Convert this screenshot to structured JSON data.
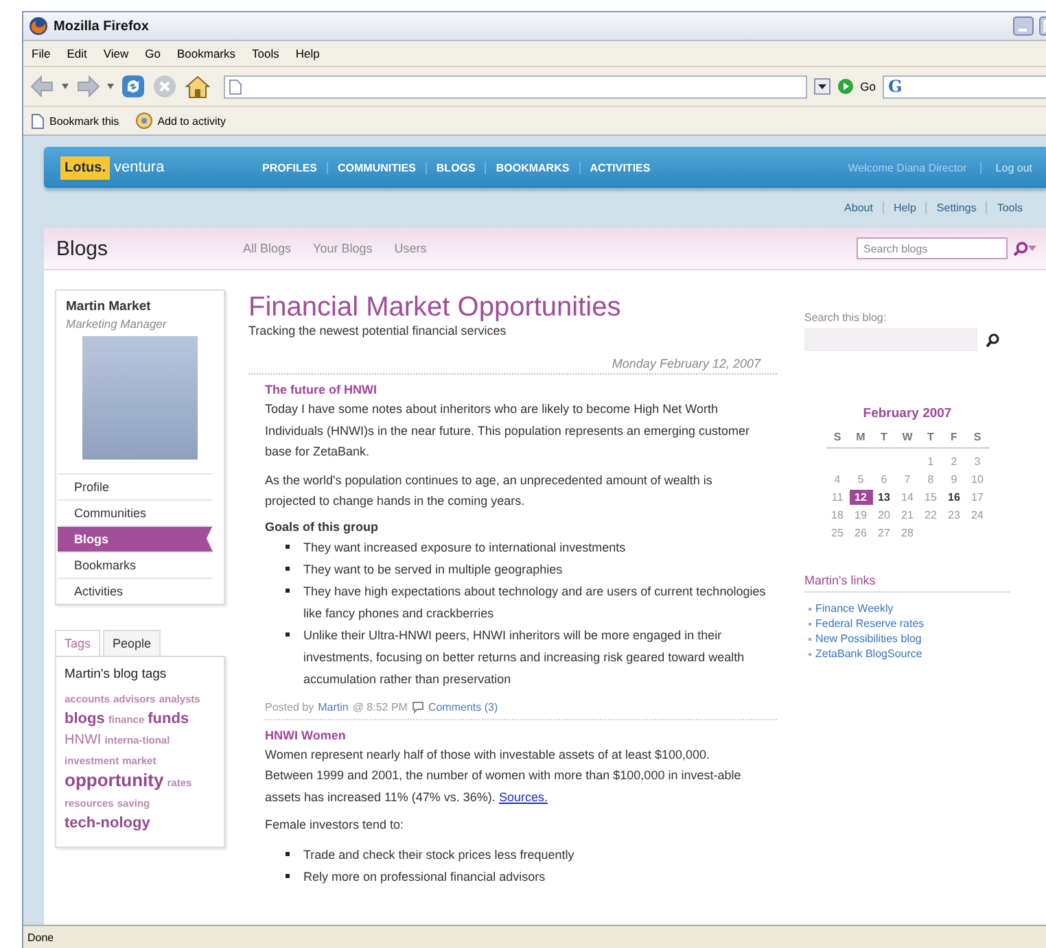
{
  "window": {
    "title": "Mozilla Firefox"
  },
  "menu": [
    "File",
    "Edit",
    "View",
    "Go",
    "Bookmarks",
    "Tools",
    "Help"
  ],
  "toolbar": {
    "go_label": "Go",
    "search_engine": "G"
  },
  "bookmarks_bar": [
    "Bookmark this",
    "Add to activity"
  ],
  "app": {
    "logo": {
      "brand": "Lotus.",
      "product": "ventura"
    },
    "nav": [
      "PROFILES",
      "COMMUNITIES",
      "BLOGS",
      "BOOKMARKS",
      "ACTIVITIES"
    ],
    "welcome": "Welcome Diana Director",
    "logout": "Log out",
    "utility_links": [
      "About",
      "Help",
      "Settings",
      "Tools"
    ]
  },
  "blogs_header": {
    "title": "Blogs",
    "tabs": [
      "All Blogs",
      "Your Blogs",
      "Users"
    ],
    "search_placeholder": "Search blogs"
  },
  "profile": {
    "name": "Martin Market",
    "role": "Marketing Manager",
    "menu": [
      {
        "label": "Profile",
        "selected": false
      },
      {
        "label": "Communities",
        "selected": false
      },
      {
        "label": "Blogs",
        "selected": true
      },
      {
        "label": "Bookmarks",
        "selected": false
      },
      {
        "label": "Activities",
        "selected": false
      }
    ]
  },
  "tag_panel": {
    "tabs": [
      {
        "label": "Tags",
        "selected": true
      },
      {
        "label": "People",
        "selected": false
      }
    ],
    "heading": "Martin's blog tags",
    "tags": [
      {
        "text": "accounts",
        "kind": "small"
      },
      {
        "text": "advisors",
        "kind": "small"
      },
      {
        "text": "analysts",
        "kind": "small"
      },
      {
        "text": "blogs",
        "kind": "bold"
      },
      {
        "text": "finance",
        "kind": "small"
      },
      {
        "text": "funds",
        "kind": "bold"
      },
      {
        "text": "HNWI",
        "kind": "plain"
      },
      {
        "text": "interna-tional",
        "kind": "small"
      },
      {
        "text": "investment",
        "kind": "small"
      },
      {
        "text": "market",
        "kind": "small"
      },
      {
        "text": "opportunity",
        "kind": "large"
      },
      {
        "text": "rates",
        "kind": "small"
      },
      {
        "text": "resources",
        "kind": "small"
      },
      {
        "text": "saving",
        "kind": "small"
      },
      {
        "text": "tech-nology",
        "kind": "bold"
      }
    ]
  },
  "blog": {
    "title": "Financial Market Opportunities",
    "subtitle": "Tracking the newest potential financial services"
  },
  "posts": [
    {
      "date": "Monday February 12, 2007",
      "title": "The future of HNWI",
      "body": [
        {
          "kind": "paragraph",
          "text": "Today I have some notes about inheritors who are likely to become High Net Worth Individuals (HNWI)s in the near future. This population represents an emerging customer base for ZetaBank."
        },
        {
          "kind": "paragraph",
          "text": "As the world's population continues to age, an unprecedented amount of wealth is projected to change hands in the coming years."
        },
        {
          "kind": "heading",
          "text": "Goals of this group"
        },
        {
          "kind": "list",
          "items": [
            "They want increased exposure to international investments",
            "They want to be served in multiple geographies",
            "They have high expectations about technology and are users of current technologies like fancy phones and crackberries",
            "Unlike their Ultra-HNWI peers, HNWI inheritors will be more engaged in their investments, focusing on better returns and increasing risk geared toward wealth accumulation rather than preservation"
          ]
        }
      ],
      "meta": {
        "posted_by": "Posted by",
        "author": "Martin",
        "time": "@ 8:52 PM",
        "comments": "Comments (3)"
      }
    },
    {
      "title": "HNWI Women",
      "body": [
        {
          "kind": "paragraph",
          "text": "Women represent nearly half of those with investable assets of at least $100,000. Between 1999 and 2001, the number of women with more than $100,000 in invest-able assets has increased 11% (47% vs. 36%).",
          "link": "Sources."
        },
        {
          "kind": "paragraph",
          "text": "Female investors tend to:"
        },
        {
          "kind": "list",
          "items": [
            "Trade and check their stock prices less frequently",
            "Rely more on professional financial advisors"
          ]
        }
      ]
    }
  ],
  "right": {
    "search_label": "Search this blog:",
    "calendar": {
      "title": "February 2007",
      "weekdays": [
        "S",
        "M",
        "T",
        "W",
        "T",
        "F",
        "S"
      ],
      "weeks": [
        [
          {
            "day": "1",
            "selected": false,
            "bold": false
          },
          {
            "day": "2",
            "selected": false,
            "bold": false
          },
          {
            "day": "3",
            "selected": false,
            "bold": false
          }
        ],
        [
          {
            "day": "4",
            "selected": false,
            "bold": false
          },
          {
            "day": "5",
            "selected": false,
            "bold": false
          },
          {
            "day": "6",
            "selected": false,
            "bold": false
          },
          {
            "day": "7",
            "selected": false,
            "bold": false
          },
          {
            "day": "8",
            "selected": false,
            "bold": false
          },
          {
            "day": "9",
            "selected": false,
            "bold": false
          },
          {
            "day": "10",
            "selected": false,
            "bold": false
          }
        ],
        [
          {
            "day": "11",
            "selected": false,
            "bold": false
          },
          {
            "day": "12",
            "selected": true,
            "bold": true
          },
          {
            "day": "13",
            "selected": false,
            "bold": true
          },
          {
            "day": "14",
            "selected": false,
            "bold": false
          },
          {
            "day": "15",
            "selected": false,
            "bold": false
          },
          {
            "day": "16",
            "selected": false,
            "bold": true
          },
          {
            "day": "17",
            "selected": false,
            "bold": false
          }
        ],
        [
          {
            "day": "18",
            "selected": false,
            "bold": false
          },
          {
            "day": "19",
            "selected": false,
            "bold": false
          },
          {
            "day": "20",
            "selected": false,
            "bold": false
          },
          {
            "day": "21",
            "selected": false,
            "bold": false
          },
          {
            "day": "22",
            "selected": false,
            "bold": false
          },
          {
            "day": "23",
            "selected": false,
            "bold": false
          },
          {
            "day": "24",
            "selected": false,
            "bold": false
          }
        ],
        [
          {
            "day": "25",
            "selected": false,
            "bold": false
          },
          {
            "day": "26",
            "selected": false,
            "bold": false
          },
          {
            "day": "27",
            "selected": false,
            "bold": false
          },
          {
            "day": "28",
            "selected": false,
            "bold": false
          }
        ]
      ]
    },
    "links_title": "Martin's links",
    "links": [
      "Finance Weekly",
      "Federal Reserve rates",
      "New Possibilities blog",
      "ZetaBank BlogSource"
    ]
  },
  "status_bar": {
    "text": "Done"
  }
}
